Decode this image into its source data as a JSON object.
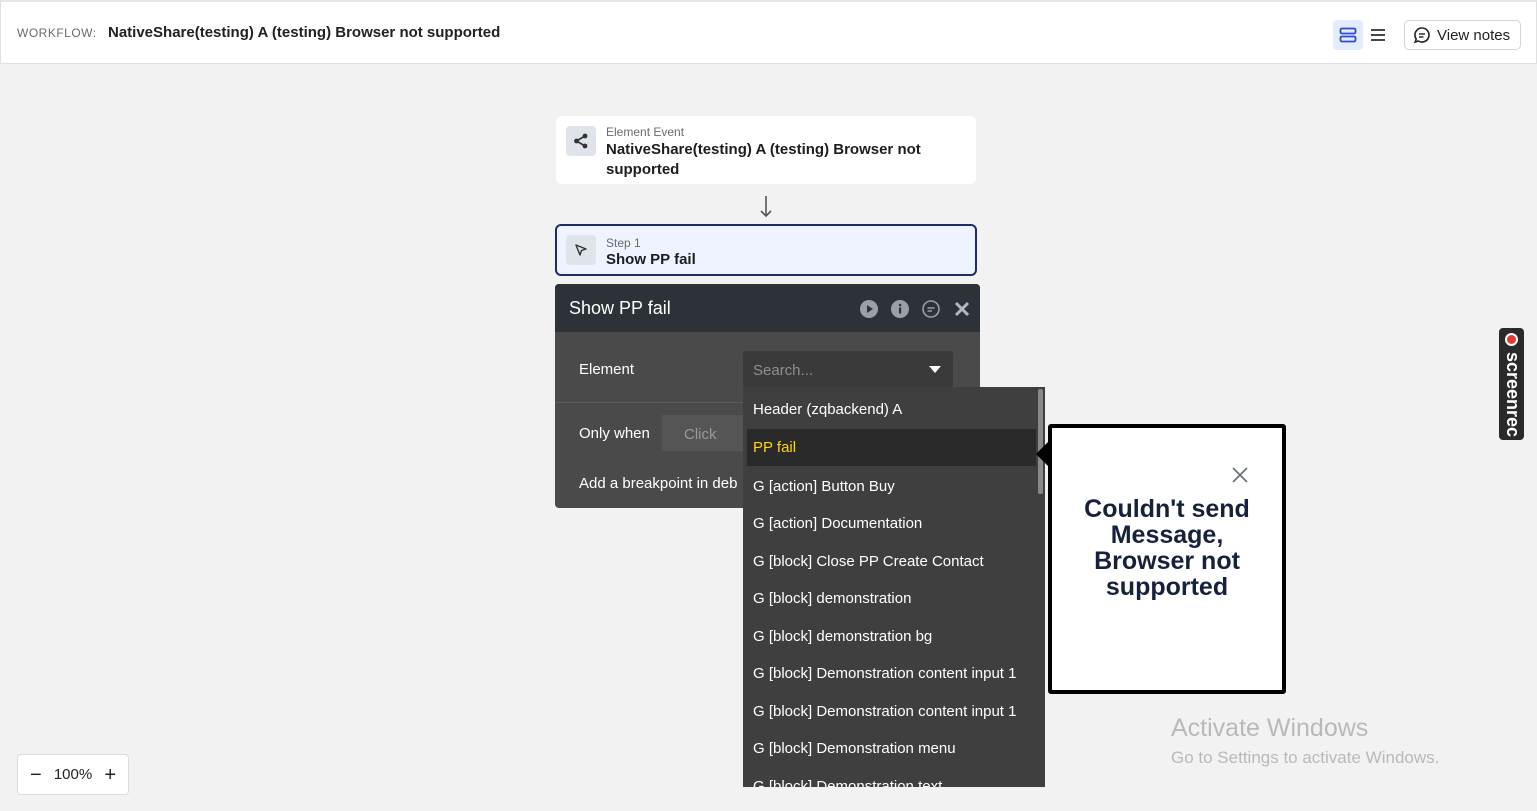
{
  "header": {
    "workflow_label": "WORKFLOW:",
    "workflow_title": "NativeShare(testing) A (testing) Browser not supported",
    "view_notes_label": "View notes"
  },
  "event_card": {
    "subtitle": "Element Event",
    "title": "NativeShare(testing) A (testing) Browser not supported"
  },
  "step_card": {
    "subtitle": "Step 1",
    "title": "Show PP fail"
  },
  "panel": {
    "title": "Show PP fail",
    "element_label": "Element",
    "search_placeholder": "Search...",
    "only_when_label": "Only when",
    "click_placeholder": "Click",
    "breakpoint_label": "Add a breakpoint in deb"
  },
  "dropdown": {
    "items": [
      "Header (zqbackend) A",
      "PP fail",
      "G [action] Button Buy",
      "G [action] Documentation",
      "G [block] Close PP Create Contact",
      "G [block] demonstration",
      "G [block] demonstration bg",
      "G [block] Demonstration content input 1",
      "G [block] Demonstration content input 1",
      "G [block] Demonstration menu",
      "G [block] Demonstration text"
    ],
    "selected": "PP fail"
  },
  "popup": {
    "message": "Couldn't send Message, Browser not supported"
  },
  "watermark": {
    "line1": "Activate Windows",
    "line2": "Go to Settings to activate Windows."
  },
  "zoom": {
    "value": "100%",
    "minus": "−",
    "plus": "+"
  },
  "screenrec": {
    "label": "screenrec"
  },
  "colors": {
    "panel_header": "#2c3237",
    "panel_body": "#4a4a4a",
    "selected_item_text": "#ffd60a",
    "step_border": "#1d2b6b"
  }
}
